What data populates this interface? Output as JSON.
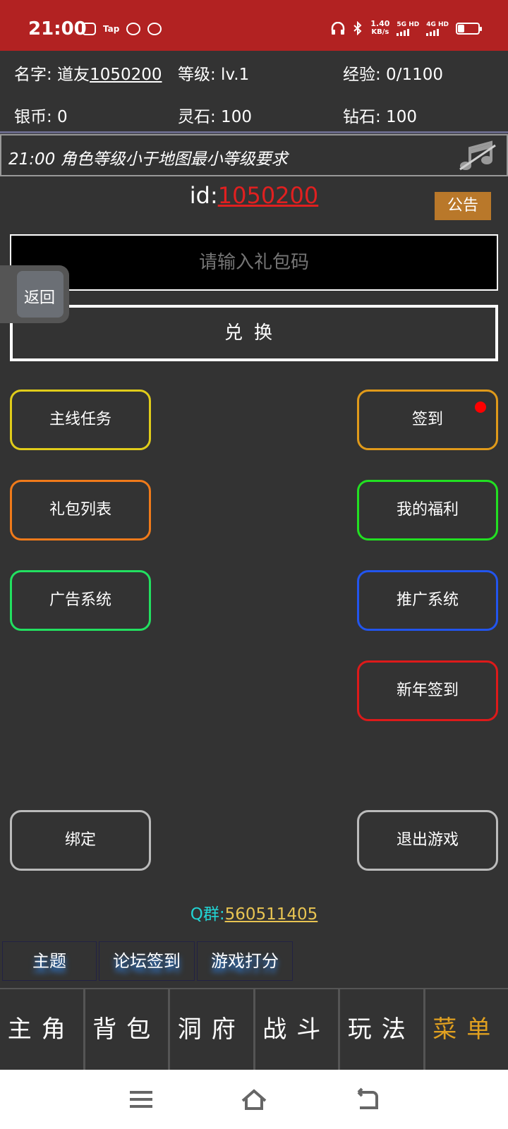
{
  "status_bar": {
    "time": "21:00",
    "tap_label": "Tap",
    "net_speed": "1.40",
    "net_unit": "KB/s",
    "net1": "5G HD",
    "net2": "4G HD"
  },
  "stats": {
    "name_label": "名字: 道友",
    "name_value": "1050200",
    "level": "等级: lv.1",
    "exp": "经验: 0/1100",
    "silver": "银币: 0",
    "spirit_stone": "灵石: 100",
    "diamond": "钻石: 100"
  },
  "notice_message": "21:00 角色等级小于地图最小等级要求",
  "id_label": "id:",
  "id_value": "1050200",
  "announcement_label": "公告",
  "code_input": {
    "placeholder": "请输入礼包码"
  },
  "redeem_label": "兑换",
  "back_label": "返回",
  "menu": {
    "main_quest": "主线任务",
    "sign_in": "签到",
    "gift_list": "礼包列表",
    "my_welfare": "我的福利",
    "ad_system": "广告系统",
    "promo_system": "推广系统",
    "new_year_sign": "新年签到",
    "bind": "绑定",
    "exit_game": "退出游戏"
  },
  "colors": {
    "main_quest": "#e0cc1a",
    "sign_in": "#e09a1a",
    "gift_list": "#f07a1a",
    "my_welfare": "#22e022",
    "ad_system": "#22e060",
    "promo_system": "#2255ee",
    "new_year_sign": "#dd1a1a",
    "bind": "#bbbbbb",
    "exit_game": "#bbbbbb"
  },
  "qq": {
    "label": "Q群:",
    "value": "560511405"
  },
  "ext_tabs": [
    "主题",
    "论坛签到",
    "游戏打分"
  ],
  "nav": [
    "主角",
    "背包",
    "洞府",
    "战斗",
    "玩法",
    "菜单"
  ],
  "nav_active": "菜单",
  "system_nav": [
    "menu-icon",
    "home-icon",
    "back-icon"
  ]
}
